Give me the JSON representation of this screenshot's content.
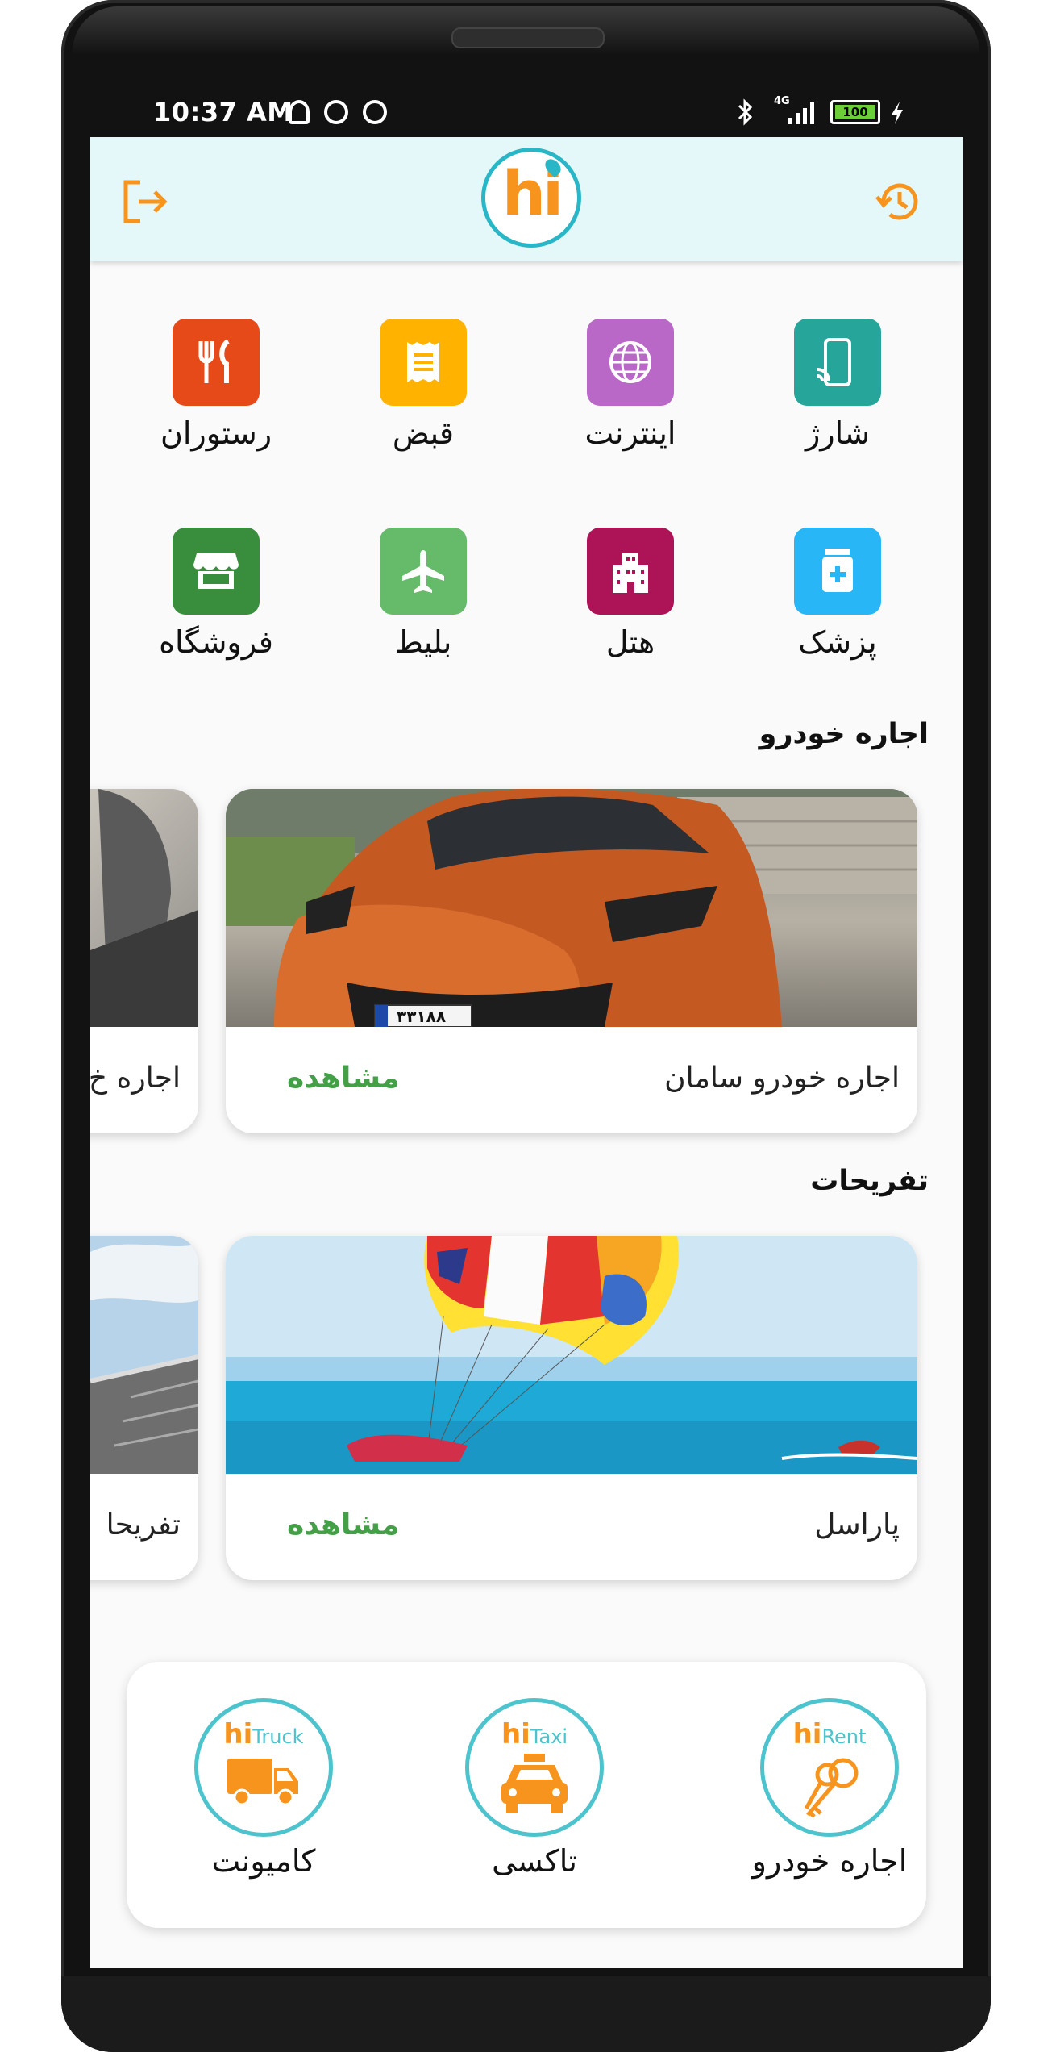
{
  "status": {
    "time": "10:37 AM",
    "network": "4G",
    "battery": "100"
  },
  "header": {
    "logo_text": "hi",
    "exit_icon": "logout-icon",
    "history_icon": "history-icon"
  },
  "categories": [
    {
      "label": "شارژ",
      "icon": "phone-charge-icon",
      "color": "#26a69a"
    },
    {
      "label": "اینترنت",
      "icon": "globe-icon",
      "color": "#ba68c8"
    },
    {
      "label": "قبض",
      "icon": "bill-icon",
      "color": "#ffb300"
    },
    {
      "label": "رستوران",
      "icon": "restaurant-icon",
      "color": "#e64a19"
    },
    {
      "label": "پزشک",
      "icon": "medical-icon",
      "color": "#29b6f6"
    },
    {
      "label": "هتل",
      "icon": "hotel-icon",
      "color": "#ad1457"
    },
    {
      "label": "بلیط",
      "icon": "airplane-icon",
      "color": "#66bb6a"
    },
    {
      "label": "فروشگاه",
      "icon": "store-icon",
      "color": "#388e3c"
    }
  ],
  "car_rental": {
    "title": "اجاره خودرو",
    "cards": [
      {
        "title": "اجاره خودرو سامان",
        "action": "مشاهده",
        "plate": "۳۳۱۸۸"
      },
      {
        "title": "اجاره خ"
      }
    ]
  },
  "entertainment": {
    "title": "تفریحات",
    "cards": [
      {
        "title": "پاراسل",
        "action": "مشاهده"
      },
      {
        "title": "تفریحا"
      }
    ]
  },
  "services": [
    {
      "brand": "hi",
      "sub": "Rent",
      "label": "اجاره خودرو",
      "icon": "keys-icon"
    },
    {
      "brand": "hi",
      "sub": "Taxi",
      "label": "تاکسی",
      "icon": "taxi-icon"
    },
    {
      "brand": "hi",
      "sub": "Truck",
      "label": "کامیونت",
      "icon": "truck-icon"
    }
  ],
  "colors": {
    "accent": "#f7941d",
    "brand_teal": "#29b6c6",
    "link_green": "#43a047",
    "header_bg": "#e4f7f9"
  }
}
